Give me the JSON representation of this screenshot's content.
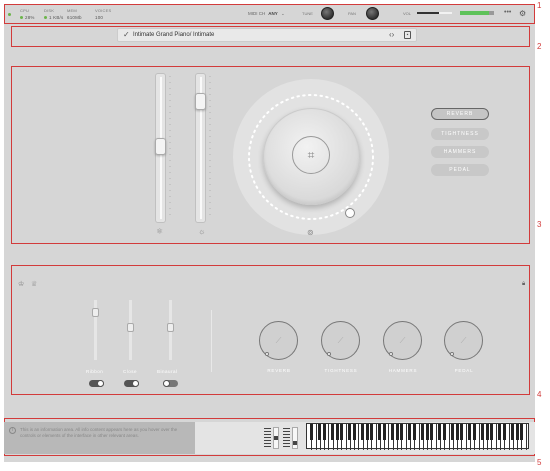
{
  "section_markers": [
    "1",
    "2",
    "3",
    "4",
    "5"
  ],
  "header": {
    "stats": [
      {
        "label": "CPU",
        "value": "28%",
        "dot": true
      },
      {
        "label": "DISK",
        "value": "1 KB/s",
        "dot": true
      },
      {
        "label": "MEM",
        "value": "610Mb",
        "dot": false
      },
      {
        "label": "VOICES",
        "value": "100",
        "dot": false
      }
    ],
    "midi_label": "MIDI CH",
    "midi_value": "ANY",
    "tune_label": "TUNE",
    "pan_label": "PAN",
    "vol_label": "VOL",
    "volume_level": 0.62,
    "meter_level": 0.85,
    "more_icon": "more-dots-icon",
    "settings_icon": "gear-icon"
  },
  "preset": {
    "name": "Intimate Grand Piano/ Intimate"
  },
  "main_controls": {
    "fader_1_level": 0.5,
    "fader_2_level": 0.85,
    "big_knob_value": 0.88,
    "fx_buttons": [
      {
        "label": "REVERB",
        "active": true
      },
      {
        "label": "TIGHTNESS",
        "active": false
      },
      {
        "label": "HAMMERS",
        "active": false
      },
      {
        "label": "PEDAL",
        "active": false
      }
    ]
  },
  "mixer": {
    "channels": [
      {
        "label": "Ribbon",
        "level": 0.85,
        "toggle_on": true
      },
      {
        "label": "Close",
        "level": 0.55,
        "toggle_on": true
      },
      {
        "label": "Binaural",
        "level": 0.55,
        "toggle_on": false
      }
    ],
    "knobs": [
      {
        "label": "REVERB"
      },
      {
        "label": "TIGHTNESS"
      },
      {
        "label": "HAMMERS"
      },
      {
        "label": "PEDAL"
      }
    ]
  },
  "info_text": "This is an information area. All info content appears here as you hover over the controls or elements of the interface in other relevant areas.",
  "colors": {
    "accent_green": "#5fc25a",
    "section_outline": "#d23b3b"
  }
}
